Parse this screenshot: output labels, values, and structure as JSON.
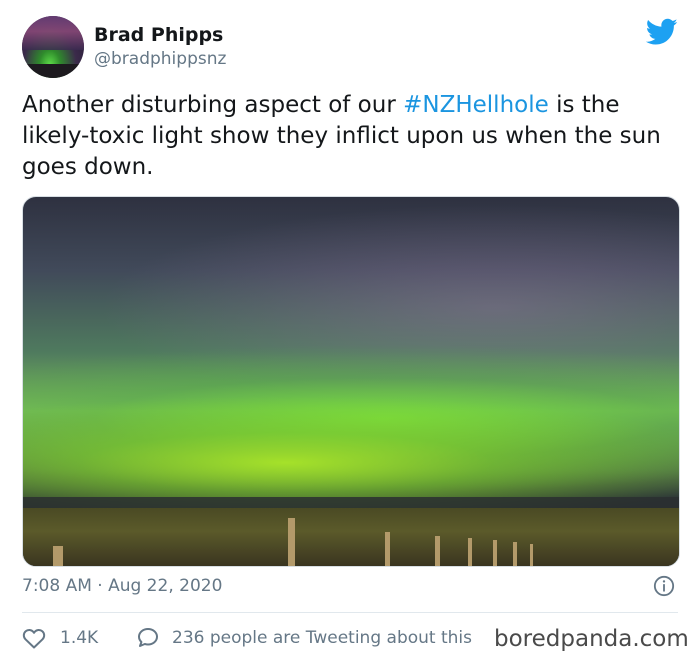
{
  "author": {
    "display_name": "Brad Phipps",
    "handle": "@bradphippsnz",
    "avatar_icon": "aurora-avatar"
  },
  "platform_icon": "twitter-bird-icon",
  "tweet": {
    "text_before": "Another disturbing aspect of our ",
    "hashtag": "#NZHellhole",
    "text_after": " is the likely-toxic light show they inflict upon us when the sun goes down."
  },
  "media": {
    "description_icon": "aurora-photo"
  },
  "timestamp": "7:08 AM · Aug 22, 2020",
  "engagement": {
    "likes": "1.4K",
    "tweeting": "236 people are Tweeting about this"
  },
  "watermark": "boredpanda.com",
  "colors": {
    "accent": "#1b95e0",
    "muted": "#657786",
    "text": "#14171a"
  }
}
